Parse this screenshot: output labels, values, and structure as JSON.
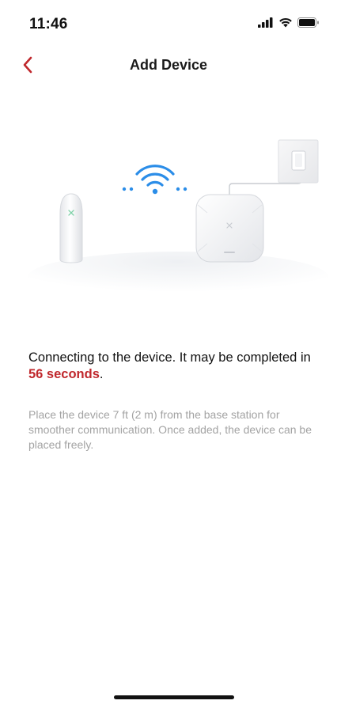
{
  "status_bar": {
    "time": "11:46",
    "icons": [
      "cellular-signal-icon",
      "wifi-icon",
      "battery-icon"
    ]
  },
  "header": {
    "title": "Add Device",
    "back_icon": "chevron-left-icon"
  },
  "illustration": {
    "items": [
      "door-sensor",
      "wifi-signal-icon",
      "base-station",
      "power-adapter"
    ]
  },
  "main": {
    "message_prefix": "Connecting to the device. It may be completed in ",
    "countdown": "56 seconds",
    "message_suffix": ".",
    "hint": "Place the device 7 ft (2 m) from the base station for smoother communication. Once added, the device can be placed freely."
  },
  "colors": {
    "accent": "#c0282d",
    "wifi": "#2b8de8",
    "hint_text": "#a3a3a3"
  }
}
